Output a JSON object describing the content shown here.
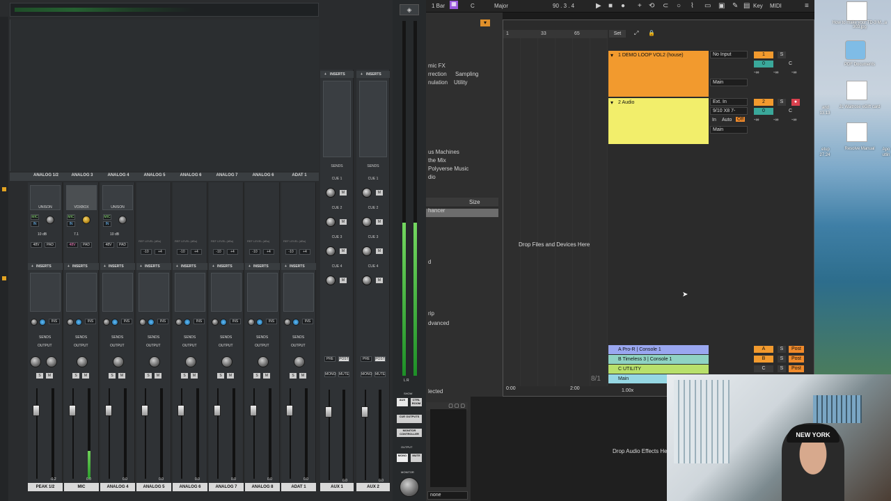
{
  "console": {
    "channels": [
      "ANALOG 1/2",
      "ANALOG 3",
      "ANALOG 4",
      "ANALOG 5",
      "ANALOG 6",
      "ANALOG 7",
      "ANALOG 6",
      "ADAT 1"
    ],
    "channel_footers": [
      "PEAK 1/2",
      "MIC",
      "ANALOG 4",
      "ANALOG 5",
      "ANALOG 6",
      "ANALOG 7",
      "ANALOG 8",
      "ADAT 1"
    ],
    "aux_footers": [
      "AUX 1",
      "AUX 2"
    ],
    "inserts_label": "INSERTS",
    "sends_label": "SENDS",
    "output_label": "OUTPUT",
    "unison_label": "UNISON",
    "voxbox_label": "VOXBOX",
    "mic_label": "MIC",
    "in_label": "IN",
    "gain_val": "10 dB",
    "gain_val2": "7.1",
    "v48": "48V",
    "pad": "PAD",
    "ref_level": "REF LEVEL (dBu)",
    "ref_m10": "-10",
    "ref_p4": "+4",
    "ins": "INS",
    "solo": "S",
    "mute": "M",
    "cue_labels": [
      "CUE 1",
      "CUE 2",
      "CUE 3",
      "CUE 4"
    ],
    "pre": "PRE",
    "post": "POST",
    "mono": "MONO",
    "mute_btn": "MUTE",
    "show_label": "SHOW",
    "aux_btn": "AUX",
    "ctrl_room": "CTRL ROOM",
    "cue_outputs": "CUE OUTPUTS",
    "monitor_controller": "MONITOR CONTROLLER",
    "output_head": "OUTPUT",
    "monitor_head": "MONITOR",
    "lr": "L  R",
    "fader_vals": [
      "-0.2",
      "0.0",
      "0.0",
      "0.0",
      "0.0",
      "0.0",
      "0.0",
      "0.0"
    ],
    "aux_fader_vals": [
      "0.0",
      "0.0"
    ]
  },
  "topbar": {
    "bar": "1 Bar",
    "key": "C",
    "scale": "Major",
    "position": "90 .  3 .  4",
    "key_btn": "Key",
    "midi_btn": "MIDI"
  },
  "browser": {
    "items_top": [
      "mic FX",
      "rrection",
      "nulation"
    ],
    "items_top_right": [
      "Sampling",
      "Utility"
    ],
    "items_mid": [
      "us Machines",
      "the Mix",
      "Polyverse Music",
      "dio"
    ],
    "size_head": "Size",
    "items_low": [
      "hancer",
      "d",
      "rip",
      "dvanced"
    ],
    "selected": "lected",
    "none_select": "none"
  },
  "arrangement": {
    "ruler": [
      "1",
      "33",
      "65"
    ],
    "set_label": "Set",
    "drop_files": "Drop Files and Devices Here",
    "drop_effects": "Drop Audio Effects Here",
    "time_0": "0:00",
    "time_2": "2:00",
    "zoom": "1.00x",
    "fraction": "8/1",
    "tracks": [
      {
        "name": "1 DEMO LOOP VOL2 (house)",
        "color": "#f29a2e",
        "input": "No Input",
        "out": "Main",
        "num": "1"
      },
      {
        "name": "2 Audio",
        "color": "#f2ee6b",
        "input": "Ext. In",
        "sub": "9/10 X8 7-",
        "out": "Main",
        "num": "2"
      }
    ],
    "returns": [
      {
        "name": "A Pro-R | Console 1",
        "color": "#9aa7f0",
        "letter": "A"
      },
      {
        "name": "B Timeless 3 | Console 1",
        "color": "#8fd3c3",
        "letter": "B"
      },
      {
        "name": "C UTILITY",
        "color": "#b8e06b",
        "letter": "C"
      },
      {
        "name": "Main",
        "color": "#96d7e3",
        "letter": ""
      }
    ],
    "vol_0": "0",
    "pan_c": "C",
    "neg_inf": "-∞",
    "s": "S",
    "in": "In",
    "auto": "Auto",
    "off": "Off",
    "post": "Post"
  },
  "desktop": {
    "icons": [
      {
        "label": "How to make your TD-3 M...a 303.jpg"
      },
      {
        "label": "PDF Documents"
      },
      {
        "label": "JL Waitrose eGift card"
      },
      {
        "label": "Resolve Manual"
      }
    ],
    "side_labels": [
      "and",
      "13.13",
      "etup",
      "27.24",
      "Apo",
      "utlin"
    ]
  },
  "webcam": {
    "cap_text": "NEW YORK"
  }
}
